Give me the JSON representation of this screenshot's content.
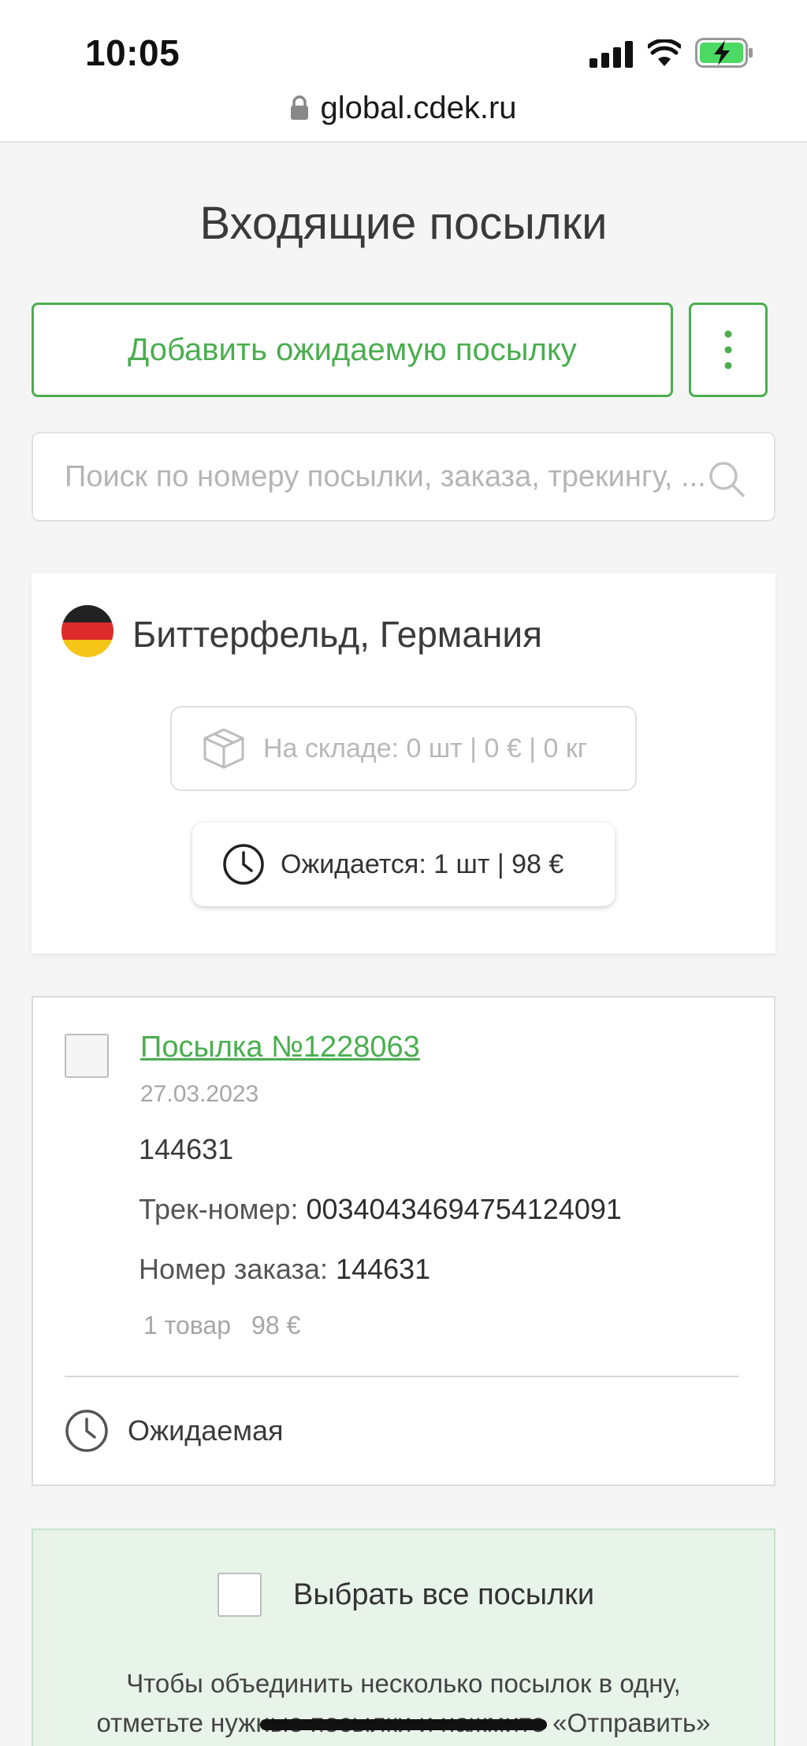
{
  "status_bar": {
    "time": "10:05",
    "url": "global.cdek.ru"
  },
  "page": {
    "title": "Входящие посылки",
    "add_button_label": "Добавить ожидаемую посылку",
    "search_placeholder": "Поиск по номеру посылки, заказа, трекингу, ..."
  },
  "warehouse": {
    "flag": "germany-flag",
    "title": "Биттерфельд, Германия",
    "stock_label": "На складе: 0 шт | 0 € | 0 кг",
    "expected_label": "Ожидается: 1 шт | 98 €"
  },
  "parcel": {
    "title": "Посылка №1228063",
    "date": "27.03.2023",
    "id_line": "144631",
    "track_label": "Трек-номер:",
    "track_value": "00340434694754124091",
    "order_label": "Номер заказа:",
    "order_value": "144631",
    "items_count": "1 товар",
    "price": "98 €",
    "status": "Ожидаемая"
  },
  "select_all": {
    "label": "Выбрать все посылки",
    "hint_line1": "Чтобы объединить несколько посылок в одну,",
    "hint_line2": "отметьте нужные посылки и нажмите «Отправить»"
  },
  "colors": {
    "accent": "#4aae4f",
    "background": "#f5f5f5",
    "select_all_bg": "#e8f3ea"
  }
}
